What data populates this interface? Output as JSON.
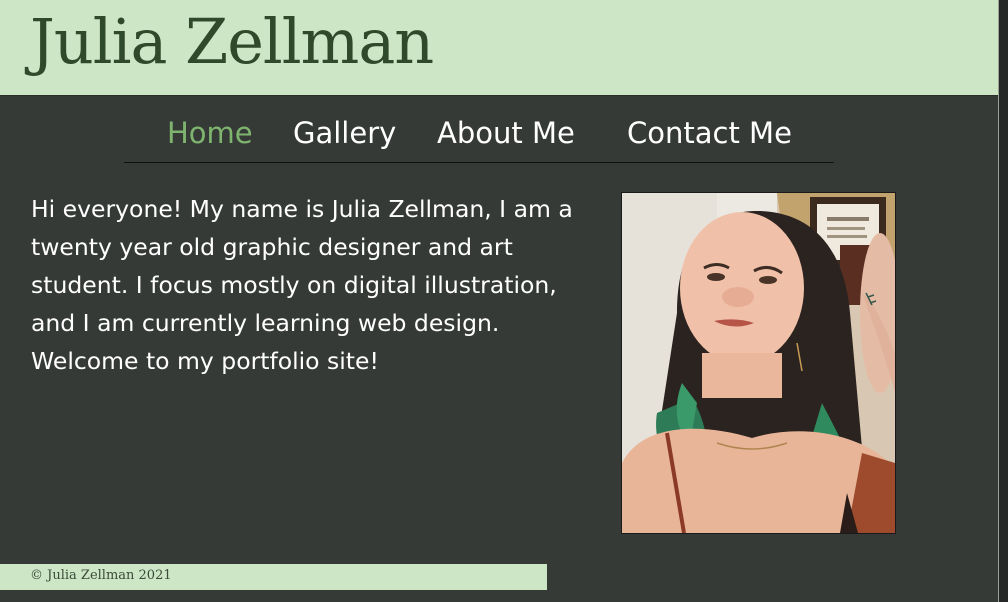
{
  "header": {
    "title": "Julia Zellman"
  },
  "nav": {
    "items": [
      {
        "label": "Home",
        "active": true
      },
      {
        "label": "Gallery",
        "active": false
      },
      {
        "label": "About Me",
        "active": false
      },
      {
        "label": "Contact Me",
        "active": false
      }
    ]
  },
  "main": {
    "intro": "Hi everyone! My name is Julia Zellman, I am a twenty year old graphic designer and art student. I focus mostly on digital illustration, and I am currently learning web design. Welcome to my portfolio site!",
    "photo": {
      "subject": "portrait-photo"
    }
  },
  "footer": {
    "copyright": "© Julia Zellman 2021"
  },
  "colors": {
    "background": "#363a37",
    "header_bg": "#cde6c6",
    "title": "#2f4a2a",
    "nav_active": "#7fb46f",
    "nav_text": "#ffffff"
  }
}
